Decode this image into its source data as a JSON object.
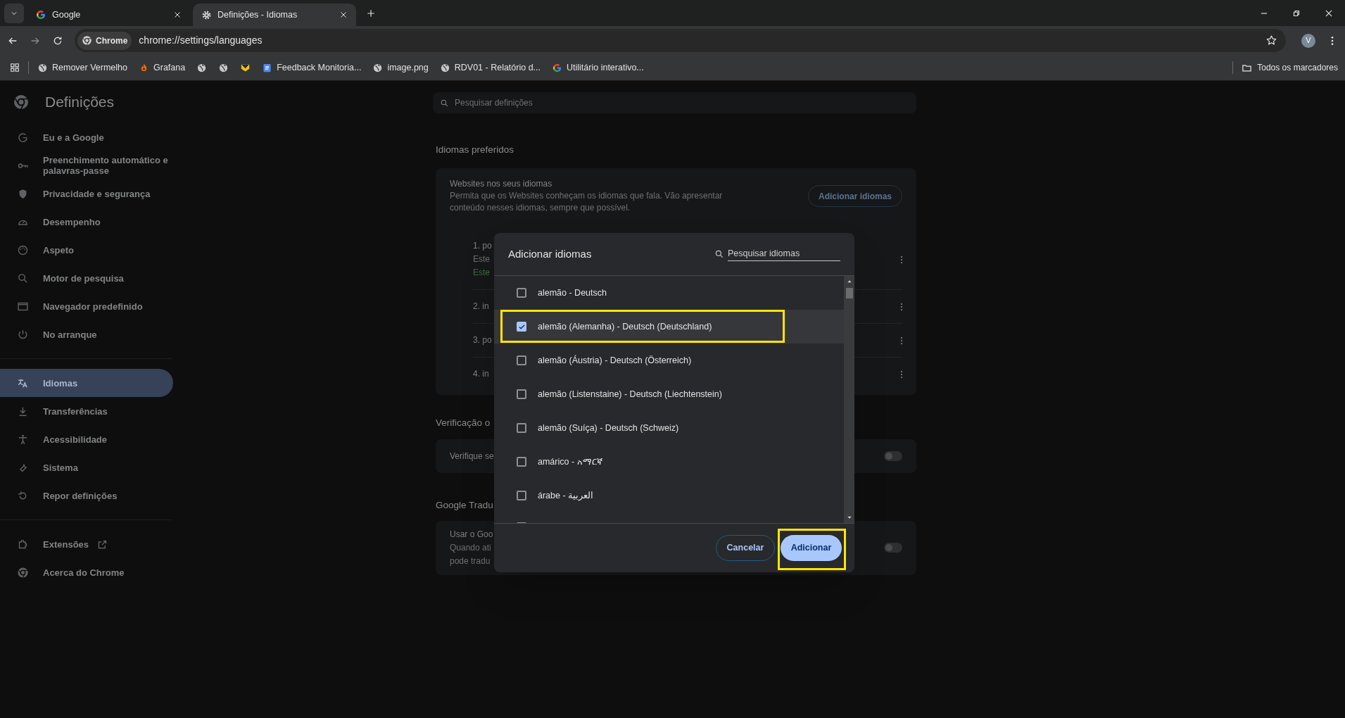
{
  "tabs": [
    {
      "title": "Google",
      "selected": false
    },
    {
      "title": "Definições - Idiomas",
      "selected": true
    }
  ],
  "address_bar": {
    "chip": "Chrome",
    "url": "chrome://settings/languages",
    "avatar": "V"
  },
  "bookmarks": [
    {
      "kind": "link",
      "label": "Remover Vermelho"
    },
    {
      "kind": "link",
      "label": "Grafana"
    },
    {
      "kind": "favicon"
    },
    {
      "kind": "favicon"
    },
    {
      "kind": "favicon"
    },
    {
      "kind": "link",
      "label": "Feedback Monitoria..."
    },
    {
      "kind": "link",
      "label": "image.png"
    },
    {
      "kind": "link",
      "label": "RDV01 - Relatório d..."
    },
    {
      "kind": "link",
      "label": "Utilitário interativo..."
    }
  ],
  "all_bookmarks": "Todos os marcadores",
  "sidebar": {
    "title": "Definições",
    "groups": [
      [
        {
          "label": "Eu e a Google",
          "selected": false,
          "external": false
        },
        {
          "label": "Preenchimento automático e palavras-passe",
          "selected": false,
          "external": false
        },
        {
          "label": "Privacidade e segurança",
          "selected": false,
          "external": false
        },
        {
          "label": "Desempenho",
          "selected": false,
          "external": false
        },
        {
          "label": "Aspeto",
          "selected": false,
          "external": false
        },
        {
          "label": "Motor de pesquisa",
          "selected": false,
          "external": false
        },
        {
          "label": "Navegador predefinido",
          "selected": false,
          "external": false
        },
        {
          "label": "No arranque",
          "selected": false,
          "external": false
        }
      ],
      [
        {
          "label": "Idiomas",
          "selected": true,
          "external": false
        },
        {
          "label": "Transferências",
          "selected": false,
          "external": false
        },
        {
          "label": "Acessibilidade",
          "selected": false,
          "external": false
        },
        {
          "label": "Sistema",
          "selected": false,
          "external": false
        },
        {
          "label": "Repor definições",
          "selected": false,
          "external": false
        }
      ],
      [
        {
          "label": "Extensões",
          "selected": false,
          "external": true
        },
        {
          "label": "Acerca do Chrome",
          "selected": false,
          "external": false
        }
      ]
    ]
  },
  "search": {
    "placeholder": "Pesquisar definições"
  },
  "preferred": {
    "heading": "Idiomas preferidos",
    "title": "Websites nos seus idiomas",
    "description": "Permita que os Websites conheçam os idiomas que fala. Vão apresentar conteúdo nesses idiomas, sempre que possível.",
    "button": "Adicionar idiomas",
    "languages": [
      {
        "lines": [
          "1. po",
          "Este",
          "Este"
        ]
      },
      {
        "lines": [
          "2. in"
        ]
      },
      {
        "lines": [
          "3. po"
        ]
      },
      {
        "lines": [
          "4. in"
        ]
      }
    ]
  },
  "spellcheck": {
    "heading": "Verificação o",
    "label": "Verifique se",
    "on": false
  },
  "translate": {
    "heading": "Google Tradu",
    "lines": [
      "Usar o Goo",
      "Quando ati",
      "pode tradu"
    ],
    "on": false
  },
  "dialog": {
    "title": "Adicionar idiomas",
    "search_placeholder": "Pesquisar idiomas",
    "options": [
      {
        "label": "alemão - Deutsch",
        "checked": false,
        "highlighted": false
      },
      {
        "label": "alemão (Alemanha) - Deutsch (Deutschland)",
        "checked": true,
        "highlighted": true
      },
      {
        "label": "alemão (Áustria) - Deutsch (Österreich)",
        "checked": false,
        "highlighted": false
      },
      {
        "label": "alemão (Listenstaine) - Deutsch (Liechtenstein)",
        "checked": false,
        "highlighted": false
      },
      {
        "label": "alemão (Suíça) - Deutsch (Schweiz)",
        "checked": false,
        "highlighted": false
      },
      {
        "label": "amárico - አማርኛ",
        "checked": false,
        "highlighted": false
      },
      {
        "label": "árabe - العربية",
        "checked": false,
        "highlighted": false
      }
    ],
    "buttons": [
      {
        "label": "Cancelar",
        "kind": "secondary",
        "highlighted": false
      },
      {
        "label": "Adicionar",
        "kind": "primary",
        "highlighted": true
      }
    ]
  }
}
